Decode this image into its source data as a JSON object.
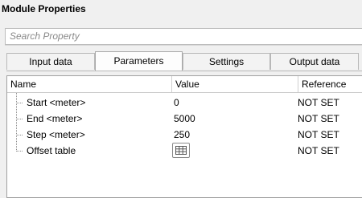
{
  "panel": {
    "title": "Module Properties"
  },
  "search": {
    "placeholder": "Search Property"
  },
  "tabs": [
    {
      "label": "Input data",
      "active": false
    },
    {
      "label": "Parameters",
      "active": true
    },
    {
      "label": "Settings",
      "active": false
    },
    {
      "label": "Output data",
      "active": false
    }
  ],
  "grid": {
    "columns": [
      "Name",
      "Value",
      "Reference"
    ],
    "rows": [
      {
        "name": "Start <meter>",
        "value": "0",
        "reference": "NOT SET"
      },
      {
        "name": "End <meter>",
        "value": "5000",
        "reference": "NOT SET"
      },
      {
        "name": "Step <meter>",
        "value": "250",
        "reference": "NOT SET"
      },
      {
        "name": "Offset table",
        "value": "",
        "value_icon": "table-grid-icon",
        "reference": "NOT SET"
      }
    ]
  },
  "colors": {
    "background": "#f0f0f0",
    "grid_bg": "#ffffff",
    "border": "#a0a0a0"
  }
}
